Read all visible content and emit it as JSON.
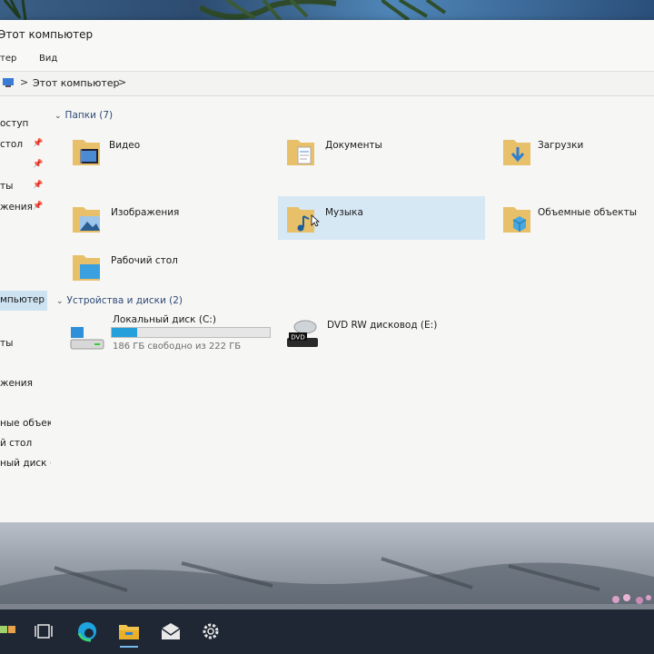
{
  "window": {
    "title": "Этот компьютер"
  },
  "ribbon": {
    "tab_computer": "тер",
    "tab_view": "Вид"
  },
  "address": {
    "location": "Этот компьютер",
    "separator": ">"
  },
  "navpane": {
    "items": [
      {
        "label": "оступ",
        "pinned": false
      },
      {
        "label": "стол",
        "pinned": true
      },
      {
        "label": "",
        "pinned": true
      },
      {
        "label": "ты",
        "pinned": true
      },
      {
        "label": "жения",
        "pinned": true
      },
      {
        "label": "мпьютер",
        "selected": true
      },
      {
        "label": "ты"
      },
      {
        "label": ""
      },
      {
        "label": "жения"
      },
      {
        "label": ""
      },
      {
        "label": "ные объекты"
      },
      {
        "label": "й стол"
      },
      {
        "label": "ный диск (C"
      }
    ]
  },
  "folders": {
    "header": "Папки (7)",
    "items": [
      {
        "label": "Видео",
        "icon": "video-folder-icon"
      },
      {
        "label": "Документы",
        "icon": "documents-folder-icon"
      },
      {
        "label": "Загрузки",
        "icon": "downloads-folder-icon"
      },
      {
        "label": "Изображения",
        "icon": "pictures-folder-icon"
      },
      {
        "label": "Музыка",
        "icon": "music-folder-icon"
      },
      {
        "label": "Объемные объекты",
        "icon": "3d-objects-folder-icon"
      },
      {
        "label": "Рабочий стол",
        "icon": "desktop-folder-icon"
      }
    ]
  },
  "devices": {
    "header": "Устройства и диски (2)",
    "items": [
      {
        "label": "Локальный диск (C:)",
        "free_text": "186 ГБ свободно из 222 ГБ",
        "used_fraction": 0.16,
        "icon": "local-disk-icon"
      },
      {
        "label": "DVD RW дисковод (E:)",
        "icon": "dvd-drive-icon",
        "icon_text": "DVD"
      }
    ]
  },
  "taskbar": {
    "items": [
      "task-view-icon",
      "edge-icon",
      "file-explorer-icon",
      "mail-icon",
      "settings-icon"
    ]
  },
  "colors": {
    "accent": "#26a0da",
    "selection": "#cde3f2",
    "taskbar": "#1e2733"
  }
}
